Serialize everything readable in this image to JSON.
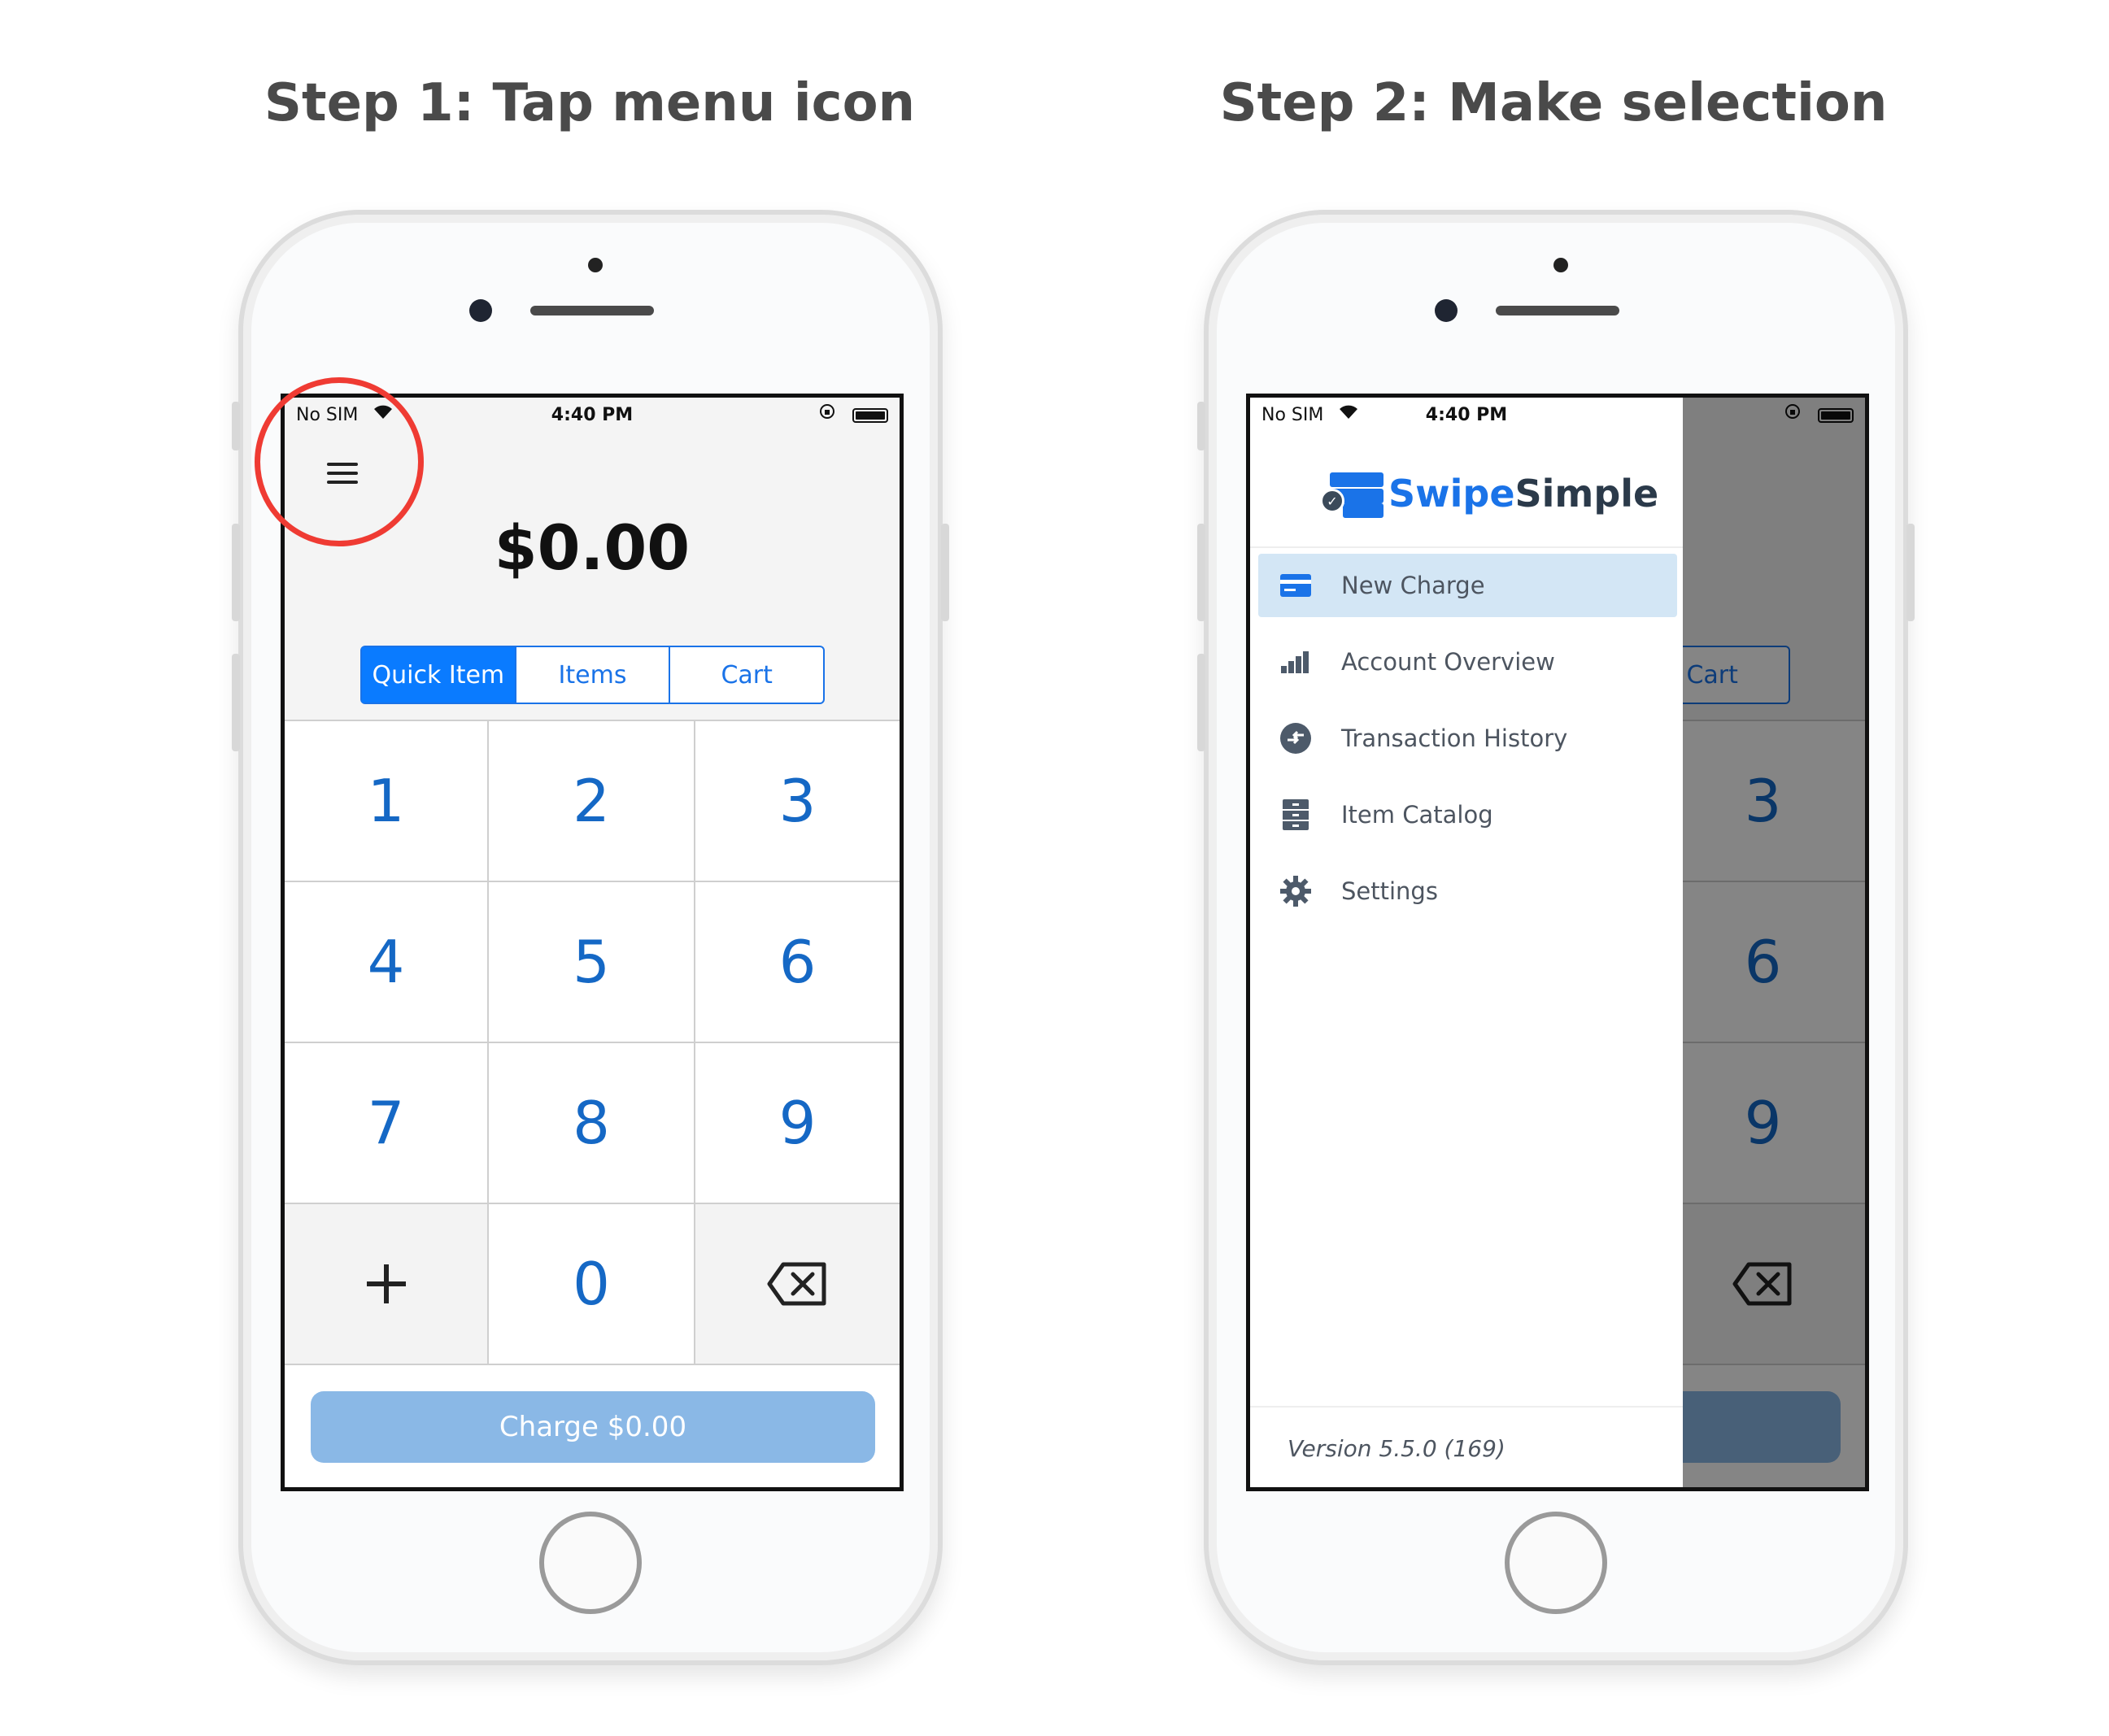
{
  "titles": {
    "step1": "Step 1: Tap menu icon",
    "step2": "Step 2: Make selection"
  },
  "status": {
    "carrier": "No SIM",
    "wifi_icon": "wifi-icon",
    "time": "4:40 PM",
    "lock_icon": "orientation-lock-icon",
    "battery_icon": "battery-icon"
  },
  "charge_screen": {
    "amount": "$0.00",
    "tabs": [
      {
        "label": "Quick Item",
        "active": true
      },
      {
        "label": "Items",
        "active": false
      },
      {
        "label": "Cart",
        "active": false
      }
    ],
    "keys": [
      "1",
      "2",
      "3",
      "4",
      "5",
      "6",
      "7",
      "8",
      "9",
      "+",
      "0",
      "⌫"
    ],
    "charge_button": "Charge $0.00"
  },
  "drawer": {
    "brand_primary": "Swipe",
    "brand_secondary": "Simple",
    "items": [
      {
        "label": "New Charge",
        "icon": "card-icon",
        "active": true
      },
      {
        "label": "Account Overview",
        "icon": "bar-chart-icon",
        "active": false
      },
      {
        "label": "Transaction History",
        "icon": "history-icon",
        "active": false
      },
      {
        "label": "Item Catalog",
        "icon": "cabinet-icon",
        "active": false
      },
      {
        "label": "Settings",
        "icon": "gear-icon",
        "active": false
      }
    ],
    "version": "Version 5.5.0 (169)"
  },
  "colors": {
    "accent": "#1a73e8",
    "segment_active": "#0a7bff",
    "keypad_digit": "#1568c5",
    "charge_button": "#8ab8e6",
    "highlight_ring": "#ef3b33",
    "drawer_active": "#d3e6f5"
  }
}
